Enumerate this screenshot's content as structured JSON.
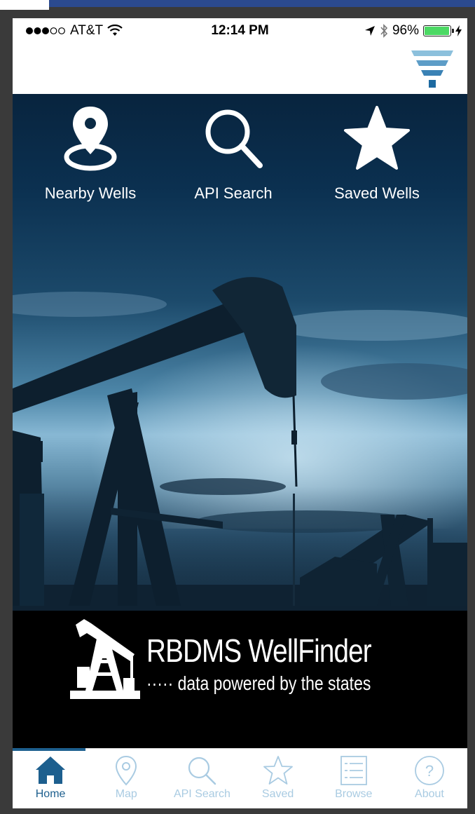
{
  "status_bar": {
    "carrier": "AT&T",
    "time": "12:14 PM",
    "battery": "96%",
    "battery_level": 0.96
  },
  "nav": {
    "filter_icon": "filter-funnel-icon"
  },
  "quick_actions": [
    {
      "label": "Nearby Wells",
      "icon": "location-pin-icon"
    },
    {
      "label": "API Search",
      "icon": "search-icon"
    },
    {
      "label": "Saved Wells",
      "icon": "star-icon"
    }
  ],
  "branding": {
    "title": "RBDMS WellFinder",
    "tagline": "data powered by the states",
    "tagline_prefix": "·····"
  },
  "tabs": [
    {
      "label": "Home",
      "icon": "home-icon",
      "active": true
    },
    {
      "label": "Map",
      "icon": "map-pin-icon",
      "active": false
    },
    {
      "label": "API Search",
      "icon": "search-icon",
      "active": false
    },
    {
      "label": "Saved",
      "icon": "star-icon",
      "active": false
    },
    {
      "label": "Browse",
      "icon": "list-icon",
      "active": false
    },
    {
      "label": "About",
      "icon": "help-icon",
      "active": false
    }
  ],
  "colors": {
    "accent": "#1d5f8e",
    "tab_inactive": "#a9cbe2",
    "battery_green": "#4cd964",
    "filter_light": "#7fb6d6",
    "filter_dark": "#1d6aa1"
  }
}
